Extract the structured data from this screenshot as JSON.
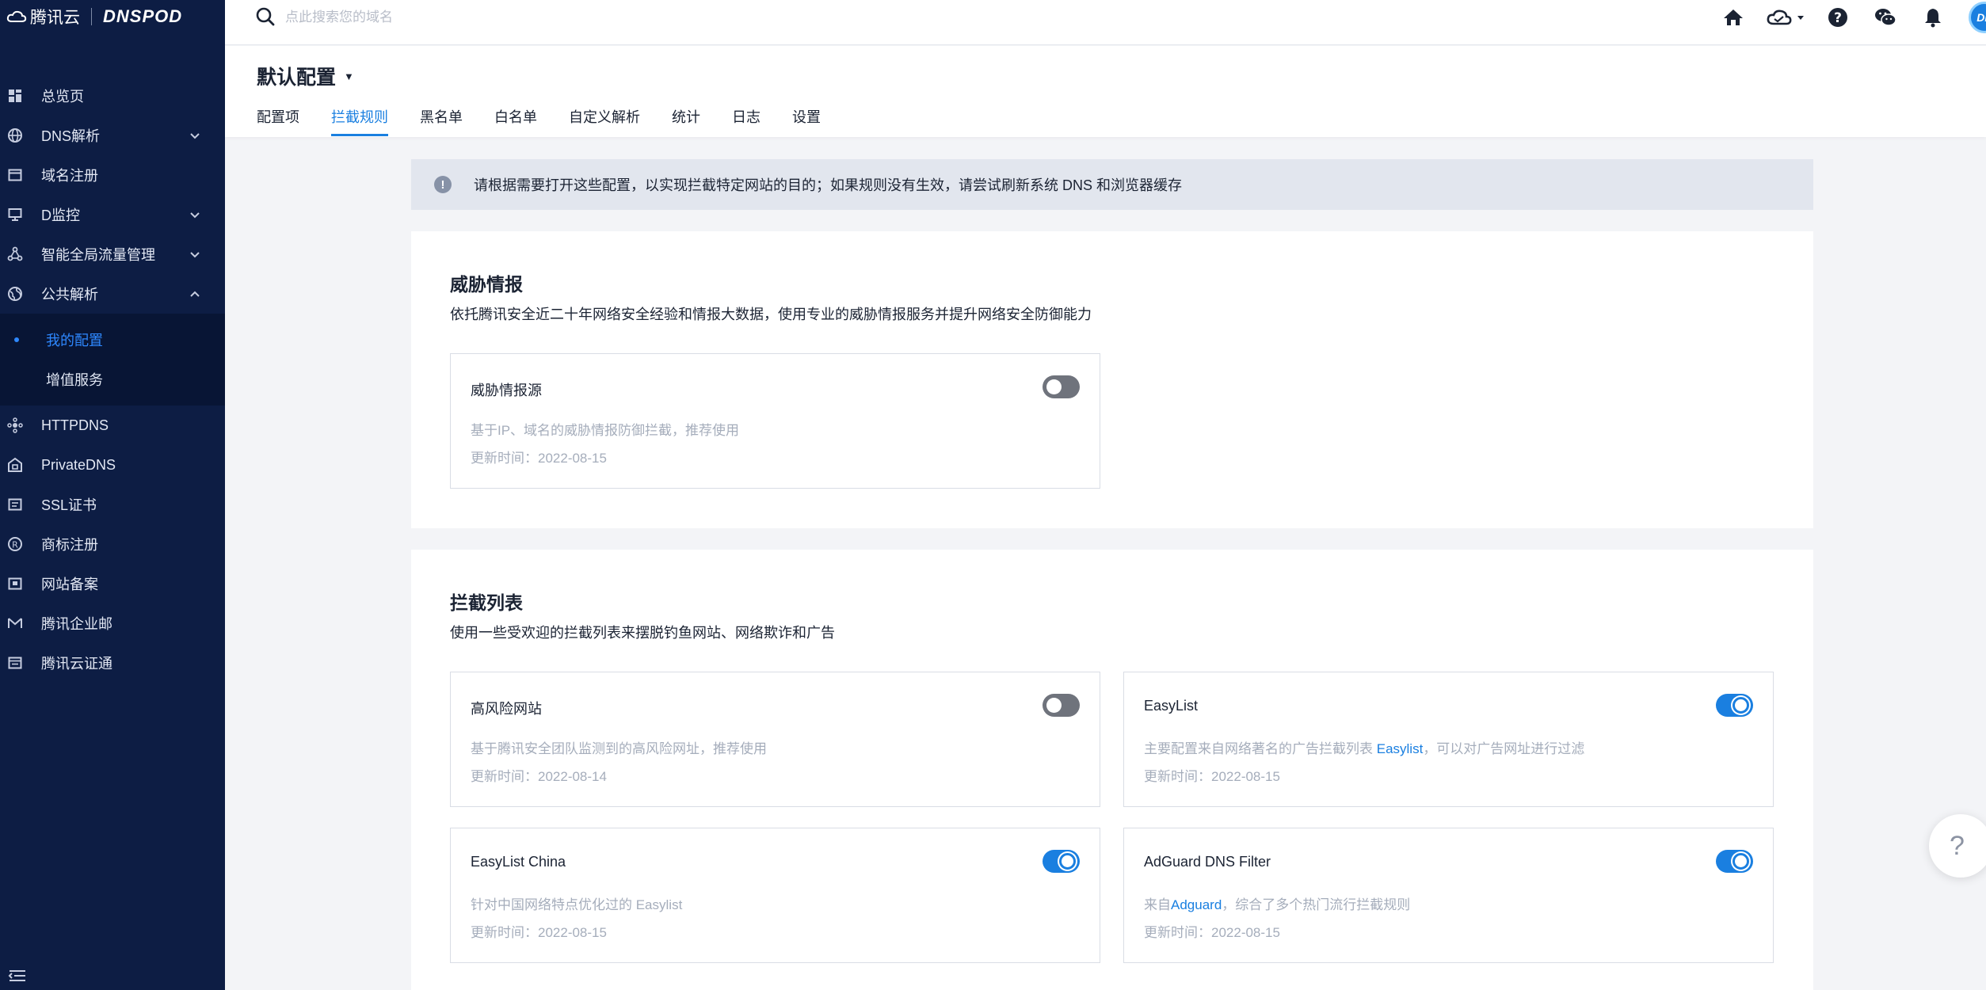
{
  "brand": {
    "name": "腾讯云",
    "product": "DNSPOD"
  },
  "search": {
    "placeholder": "点此搜索您的域名"
  },
  "user": {
    "avatar_text": "DP"
  },
  "sidebar": {
    "items": [
      {
        "label": "总览页",
        "icon": "dashboard-icon"
      },
      {
        "label": "DNS解析",
        "icon": "globe-icon",
        "expandable": true
      },
      {
        "label": "域名注册",
        "icon": "domain-icon"
      },
      {
        "label": "D监控",
        "icon": "monitor-icon",
        "expandable": true
      },
      {
        "label": "智能全局流量管理",
        "icon": "traffic-icon",
        "expandable": true
      },
      {
        "label": "公共解析",
        "icon": "public-dns-icon",
        "expandable": true,
        "expanded": true
      }
    ],
    "subitems": [
      {
        "label": "我的配置",
        "active": true
      },
      {
        "label": "增值服务"
      }
    ],
    "items_after": [
      {
        "label": "HTTPDNS",
        "icon": "httpdns-icon"
      },
      {
        "label": "PrivateDNS",
        "icon": "private-dns-icon"
      },
      {
        "label": "SSL证书",
        "icon": "ssl-icon"
      },
      {
        "label": "商标注册",
        "icon": "trademark-icon"
      },
      {
        "label": "网站备案",
        "icon": "filing-icon"
      },
      {
        "label": "腾讯企业邮",
        "icon": "mail-icon"
      },
      {
        "label": "腾讯云证通",
        "icon": "certificate-icon"
      }
    ]
  },
  "header": {
    "title": "默认配置",
    "tabs": [
      "配置项",
      "拦截规则",
      "黑名单",
      "白名单",
      "自定义解析",
      "统计",
      "日志",
      "设置"
    ],
    "active_tab": "拦截规则"
  },
  "notice": {
    "text": "请根据需要打开这些配置，以实现拦截特定网站的目的；如果规则没有生效，请尝试刷新系统 DNS 和浏览器缓存"
  },
  "threat_panel": {
    "title": "威胁情报",
    "desc": "依托腾讯安全近二十年网络安全经验和情报大数据，使用专业的威胁情报服务并提升网络安全防御能力",
    "cards": [
      {
        "name": "威胁情报源",
        "desc": "基于IP、域名的威胁情报防御拦截，推荐使用",
        "time": "更新时间：2022-08-15",
        "enabled": false
      }
    ]
  },
  "block_panel": {
    "title": "拦截列表",
    "desc": "使用一些受欢迎的拦截列表来摆脱钓鱼网站、网络欺诈和广告",
    "cards": [
      {
        "name": "高风险网站",
        "desc": "基于腾讯安全团队监测到的高风险网址，推荐使用",
        "time": "更新时间：2022-08-14",
        "enabled": false
      },
      {
        "name": "EasyList",
        "desc_pre": "主要配置来自网络著名的广告拦截列表 ",
        "desc_link": "Easylist",
        "desc_post": "，可以对广告网址进行过滤",
        "time": "更新时间：2022-08-15",
        "enabled": true
      },
      {
        "name": "EasyList China",
        "desc": "针对中国网络特点优化过的 Easylist",
        "time": "更新时间：2022-08-15",
        "enabled": true
      },
      {
        "name": "AdGuard DNS Filter",
        "desc_pre": "来自",
        "desc_link": "Adguard",
        "desc_post": "，综合了多个热门流行拦截规则",
        "time": "更新时间：2022-08-15",
        "enabled": true
      }
    ]
  },
  "help": {
    "label": "?"
  }
}
